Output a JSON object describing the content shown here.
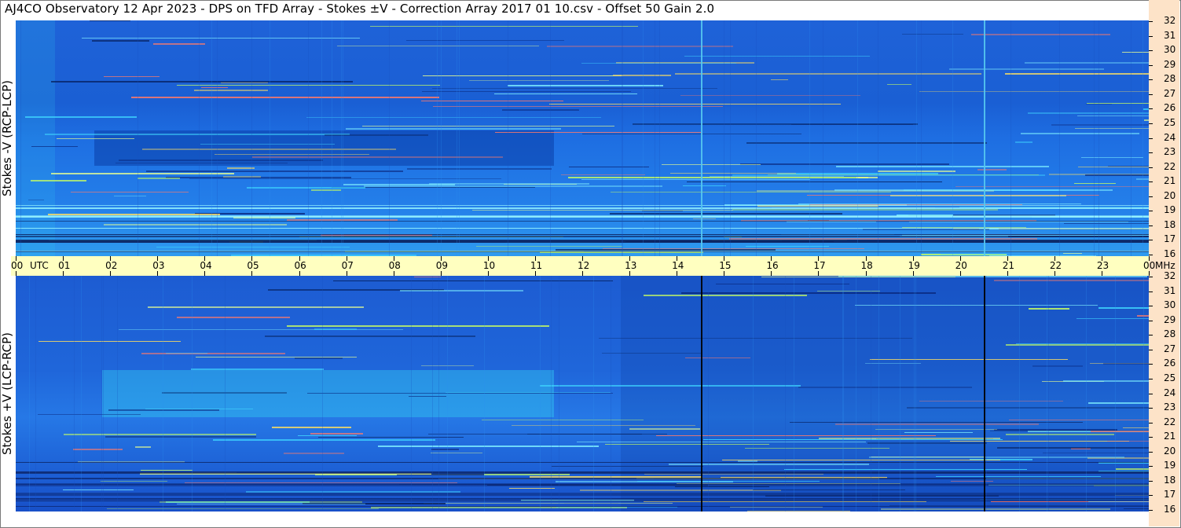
{
  "title": "AJ4CO Observatory  12 Apr 2023  -  DPS on TFD Array  -  Stokes ±V  -  Correction Array 2017 01 10.csv  -  Offset 50  Gain 2.0",
  "chart_data": {
    "type": "heatmap",
    "panels": [
      {
        "id": "top",
        "ylabel": "Stokes -V (RCP-LCP)"
      },
      {
        "id": "bottom",
        "ylabel": "Stokes +V (LCP-RCP)"
      }
    ],
    "x_axis": {
      "unit_label": "UTC",
      "ticks": [
        "00",
        "01",
        "02",
        "03",
        "04",
        "05",
        "06",
        "07",
        "08",
        "09",
        "10",
        "11",
        "12",
        "13",
        "14",
        "15",
        "16",
        "17",
        "18",
        "19",
        "20",
        "21",
        "22",
        "23",
        "00"
      ],
      "range_hours": [
        0,
        24
      ]
    },
    "y_axis": {
      "unit_label": "MHz",
      "ticks": [
        "32",
        "31",
        "30",
        "29",
        "28",
        "27",
        "26",
        "25",
        "24",
        "23",
        "22",
        "21",
        "20",
        "19",
        "18",
        "17",
        "16"
      ],
      "range_mhz": [
        16,
        32
      ]
    },
    "colors": {
      "background_blue": "#1f6fe0",
      "dark_blue": "#0a3ea8",
      "cyan": "#32c8f0",
      "time_bar": "#ffffc0",
      "freq_bar": "#fde3c8"
    }
  }
}
